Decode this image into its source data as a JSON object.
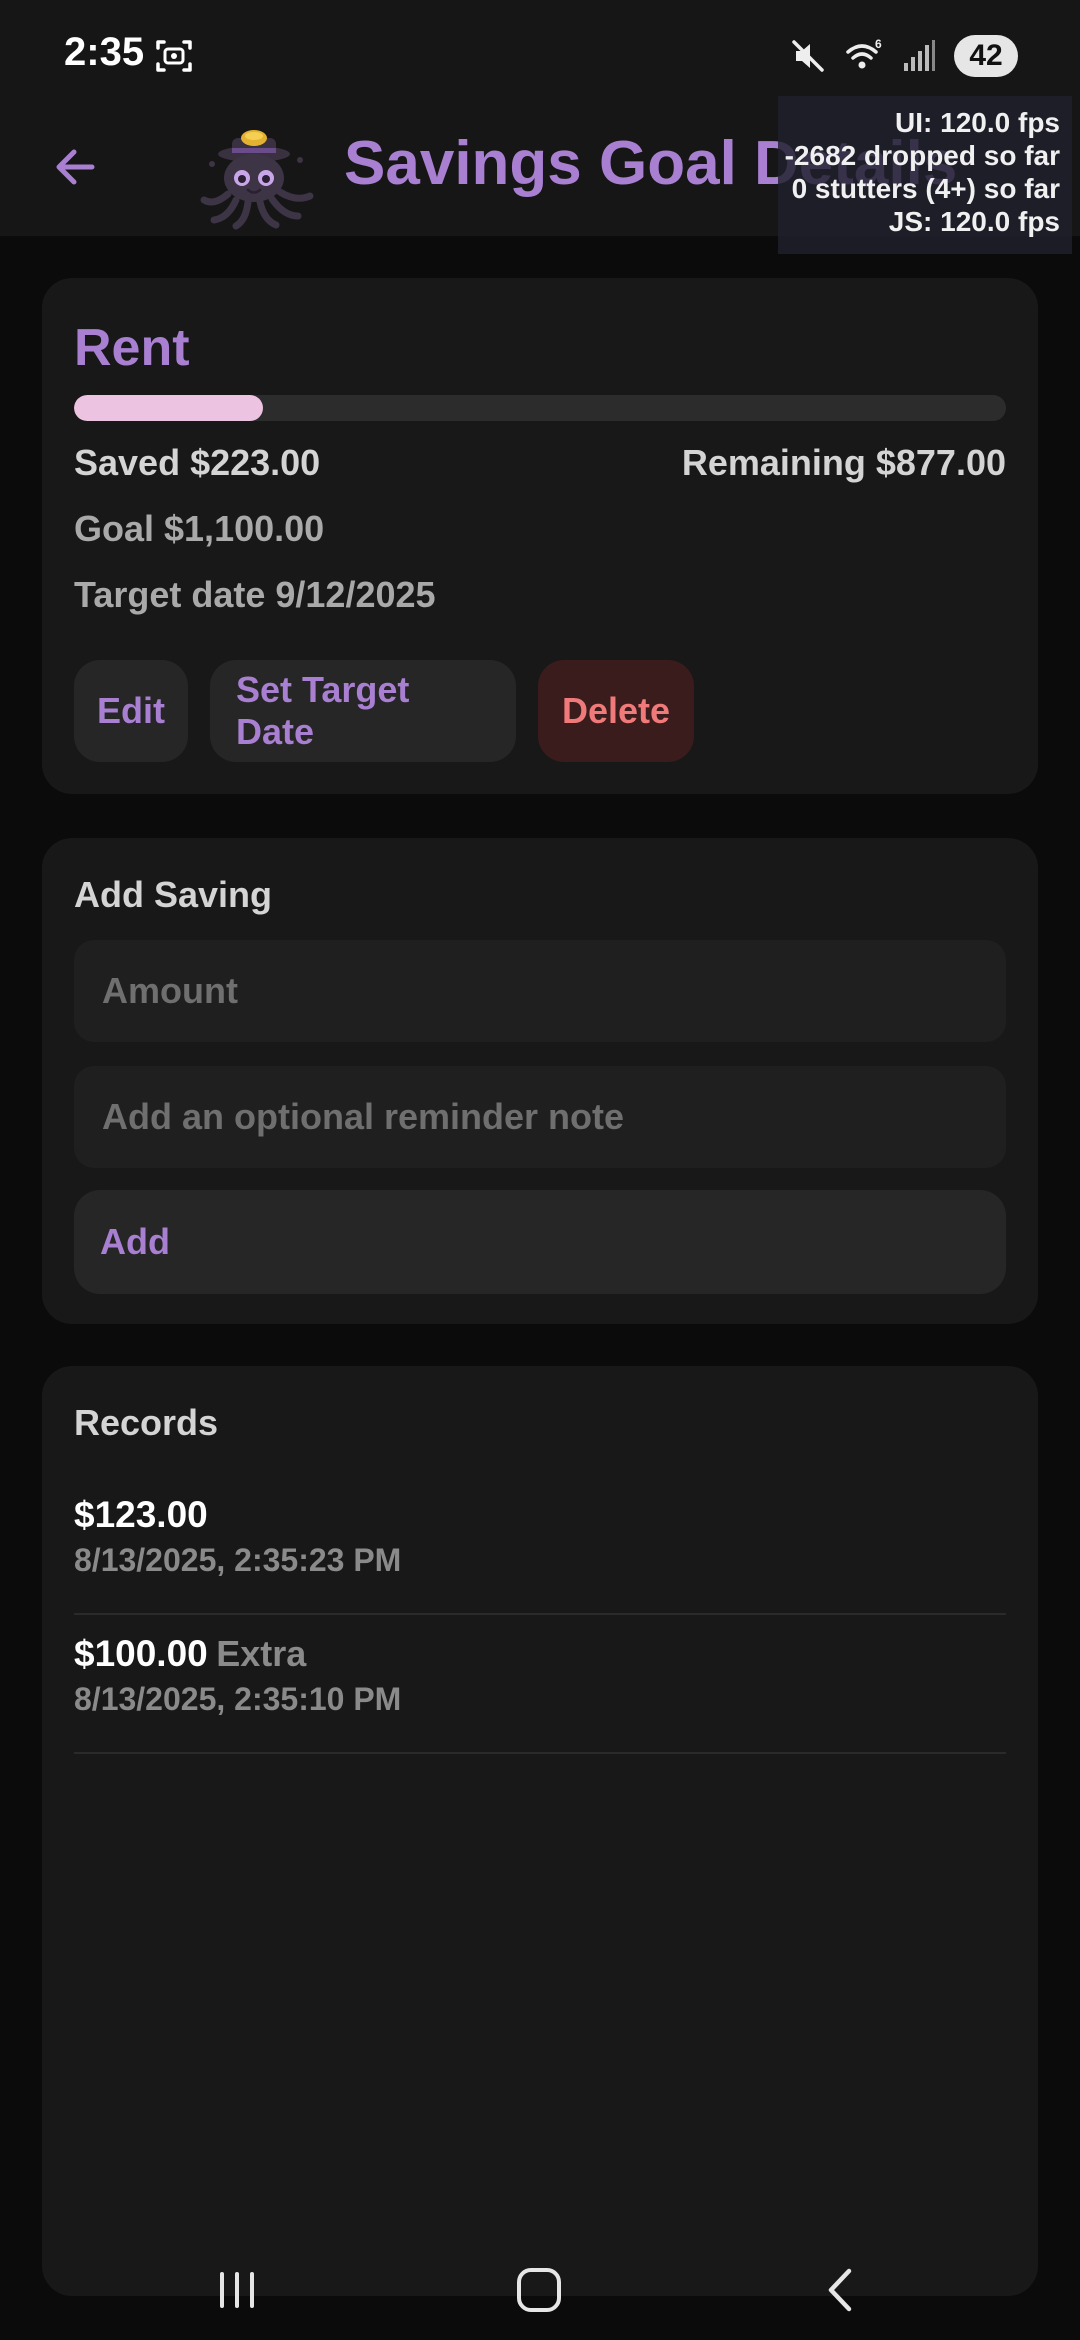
{
  "status_bar": {
    "time": "2:35",
    "battery_level": "42",
    "icons": [
      "screenshot-icon",
      "mute-icon",
      "wifi-icon",
      "signal-icon",
      "battery-icon"
    ]
  },
  "header": {
    "title": "Savings Goal Details",
    "back_icon": "arrow-left-icon",
    "mascot_icon": "octopus-mascot-icon"
  },
  "fps_overlay": {
    "ui": "UI: 120.0 fps",
    "dropped": "-2682 dropped so far",
    "stutters": "0 stutters (4+) so far",
    "js": "JS: 120.0 fps"
  },
  "goal": {
    "name": "Rent",
    "progress_fraction": 0.203,
    "saved": "Saved $223.00",
    "remaining": "Remaining $877.00",
    "goal": "Goal $1,100.00",
    "target_date": "Target date 9/12/2025",
    "actions": {
      "edit": "Edit",
      "set_target_date": "Set Target Date",
      "delete": "Delete"
    }
  },
  "add_saving": {
    "title": "Add Saving",
    "amount_placeholder": "Amount",
    "amount_value": "",
    "note_placeholder": "Add an optional reminder note",
    "note_value": "",
    "add_label": "Add"
  },
  "records": {
    "title": "Records",
    "items": [
      {
        "amount": "$123.00",
        "note": "",
        "timestamp": "8/13/2025, 2:35:23 PM"
      },
      {
        "amount": "$100.00",
        "note": "Extra",
        "timestamp": "8/13/2025, 2:35:10 PM"
      }
    ]
  },
  "colors": {
    "accent": "#a87fd1",
    "progress": "#ecc3e1",
    "danger": "#f07a7a",
    "card": "#181818",
    "background": "#0b0b0b"
  },
  "nav_bar": {
    "icons": [
      "recents-icon",
      "home-icon",
      "back-icon"
    ]
  }
}
